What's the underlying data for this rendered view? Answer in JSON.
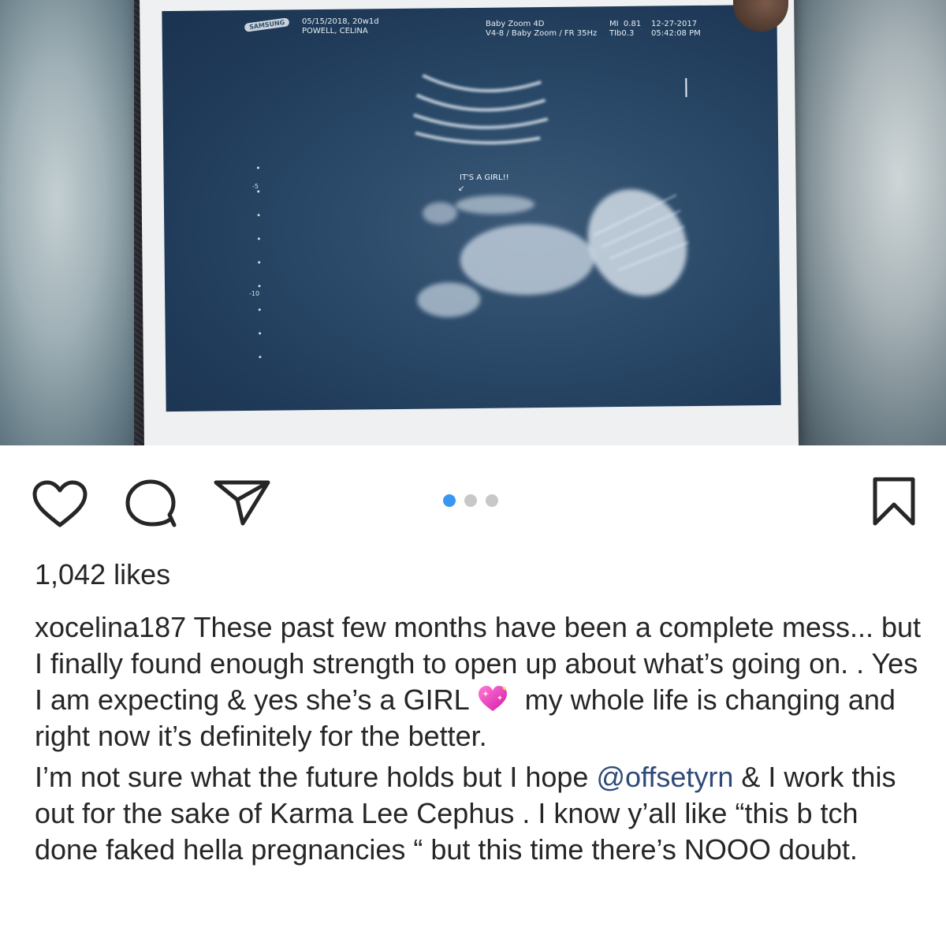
{
  "photo": {
    "machine_brand": "SAMSUNG",
    "header_left": "05/15/2018, 20w1d\nPOWELL, CELINA",
    "header_mid": "Baby Zoom 4D\nV4-8 / Baby Zoom / FR 35Hz",
    "header_right_a": "MI  0.81\nTIb0.3",
    "header_right_b": "12-27-2017\n05:42:08 PM",
    "annotation": "IT'S A GIRL!!",
    "depth_ticks": [
      "-5",
      "-10"
    ]
  },
  "actions": {
    "like_icon": "heart-icon",
    "comment_icon": "comment-icon",
    "share_icon": "paper-plane-icon",
    "save_icon": "bookmark-icon",
    "carousel": {
      "total": 3,
      "active_index": 0
    }
  },
  "post": {
    "likes": "1,042 likes",
    "username": "xocelina187",
    "paragraph1_a": " These past few months have been a complete mess... but I finally found enough strength to open up about what’s going on. . Yes I am expecting & yes she’s a GIRL",
    "paragraph1_b": " my whole life is changing and right now it’s definitely for the better.",
    "paragraph2_a": "I’m not sure what the future holds but I hope ",
    "mention": "@offsetyrn",
    "paragraph2_b": " & I work this out for the sake of Karma Lee Cephus . I know y’all like “this b tch done faked hella pregnancies “ but this time there’s NOOO doubt.",
    "emoji": "sparkling-heart-emoji"
  },
  "colors": {
    "accent_blue": "#3897f0",
    "mention": "#2f4a77",
    "text": "#262626"
  }
}
